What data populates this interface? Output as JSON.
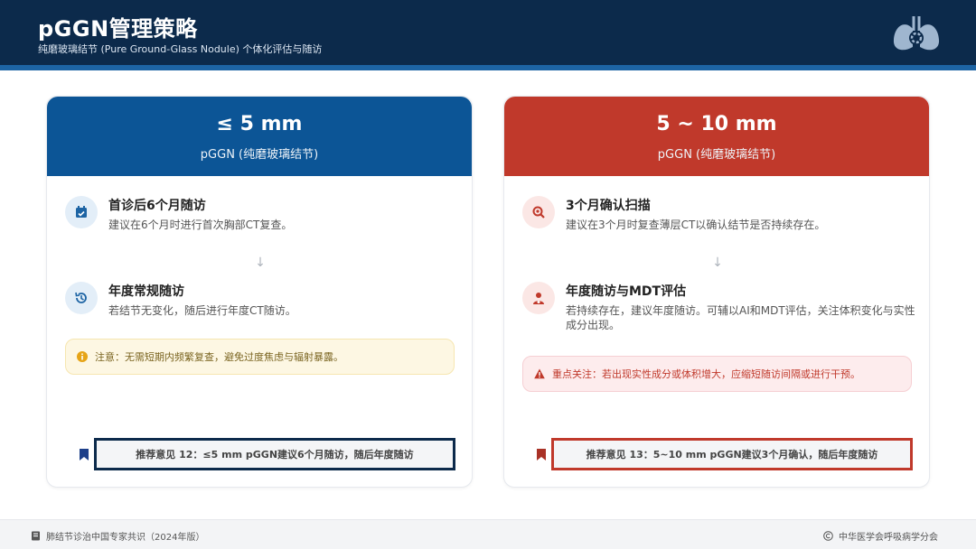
{
  "header": {
    "title": "pGGN管理策略",
    "subtitle": "纯磨玻璃结节 (Pure Ground-Glass Nodule) 个体化评估与随访",
    "logo_icon": "lung-icon"
  },
  "colors": {
    "header_bg": "#0c2a4b",
    "accent_blue": "#0c5596",
    "accent_red": "#c0392b"
  },
  "cards": [
    {
      "title": "≤ 5 mm",
      "subtitle": "pGGN (纯磨玻璃结节)",
      "steps": [
        {
          "icon": "calendar-check-icon",
          "title": "首诊后6个月随访",
          "desc": "建议在6个月时进行首次胸部CT复查。"
        },
        {
          "icon": "history-icon",
          "title": "年度常规随访",
          "desc": "若结节无变化，随后进行年度CT随访。"
        }
      ],
      "note": {
        "icon": "info-icon",
        "text": "注意：无需短期内频繁复查，避免过度焦虑与辐射暴露。"
      },
      "recommendation": "推荐意见 12：≤5 mm pGGN建议6个月随访，随后年度随访"
    },
    {
      "title": "5 ~ 10 mm",
      "subtitle": "pGGN (纯磨玻璃结节)",
      "steps": [
        {
          "icon": "search-icon",
          "title": "3个月确认扫描",
          "desc": "建议在3个月时复查薄层CT以确认结节是否持续存在。"
        },
        {
          "icon": "doctor-icon",
          "title": "年度随访与MDT评估",
          "desc": "若持续存在，建议年度随访。可辅以AI和MDT评估，关注体积变化与实性成分出现。"
        }
      ],
      "note": {
        "icon": "warning-icon",
        "text": "重点关注：若出现实性成分或体积增大，应缩短随访间隔或进行干预。"
      },
      "recommendation": "推荐意见 13：5~10 mm pGGN建议3个月确认，随后年度随访"
    }
  ],
  "footer": {
    "source": "肺结节诊治中国专家共识（2024年版）",
    "copyright": "中华医学会呼吸病学分会"
  }
}
